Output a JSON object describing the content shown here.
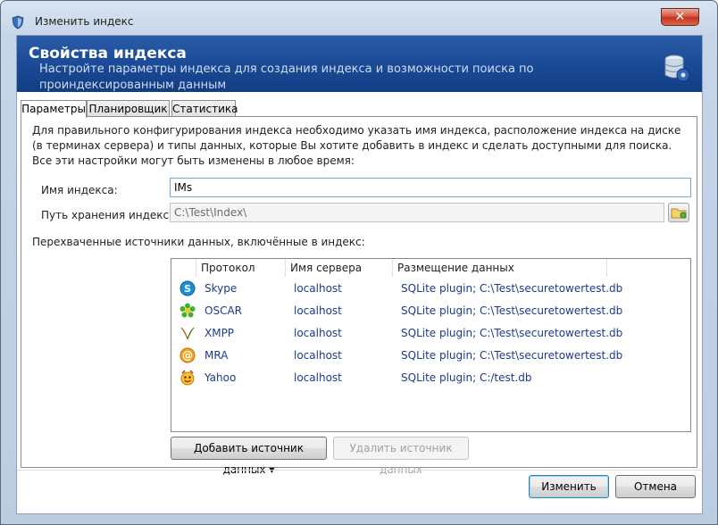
{
  "window": {
    "title": "Изменить индекс",
    "close_label": "✕"
  },
  "banner": {
    "title": "Свойства индекса",
    "subtitle": "Настройте параметры индекса для создания индекса и возможности поиска по проиндексированным данным"
  },
  "tabs": [
    {
      "label": "Параметры",
      "active": true
    },
    {
      "label": "Планировщик",
      "active": false
    },
    {
      "label": "Статистика",
      "active": false
    }
  ],
  "description": "Для правильного конфигурирования индекса необходимо указать имя индекса, расположение индекса на диске (в терминах сервера) и типы данных, которые Вы хотите добавить в индекс и сделать доступными для поиска. Все эти настройки могут быть изменены в любое время:",
  "form": {
    "name_label": "Имя индекса:",
    "name_value": "IMs",
    "path_label": "Путь хранения индекса:",
    "path_value": "C:\\Test\\Index\\"
  },
  "sources": {
    "label": "Перехваченные источники данных, включённые в индекс:",
    "columns": [
      "Протокол",
      "Имя сервера",
      "Размещение данных"
    ],
    "rows": [
      {
        "icon": "skype-icon",
        "protocol": "Skype",
        "server": "localhost",
        "location": "SQLite plugin; C:\\Test\\securetowertest.db"
      },
      {
        "icon": "icq-flower-icon",
        "protocol": "OSCAR",
        "server": "localhost",
        "location": "SQLite plugin; C:\\Test\\securetowertest.db"
      },
      {
        "icon": "xmpp-icon",
        "protocol": "XMPP",
        "server": "localhost",
        "location": "SQLite plugin; C:\\Test\\securetowertest.db"
      },
      {
        "icon": "mra-at-icon",
        "protocol": "MRA",
        "server": "localhost",
        "location": "SQLite plugin; C:\\Test\\securetowertest.db"
      },
      {
        "icon": "yahoo-icon",
        "protocol": "Yahoo",
        "server": "localhost",
        "location": "SQLite plugin; C:/test.db"
      }
    ]
  },
  "buttons": {
    "add_source": "Добавить источник данных",
    "add_source_arrow": "▾",
    "remove_source": "Удалить источник данных",
    "ok": "Изменить",
    "cancel": "Отмена"
  },
  "colors": {
    "banner": "#1b4b97",
    "link_text": "#1c3a8a",
    "frame": "#c6d5e8"
  }
}
